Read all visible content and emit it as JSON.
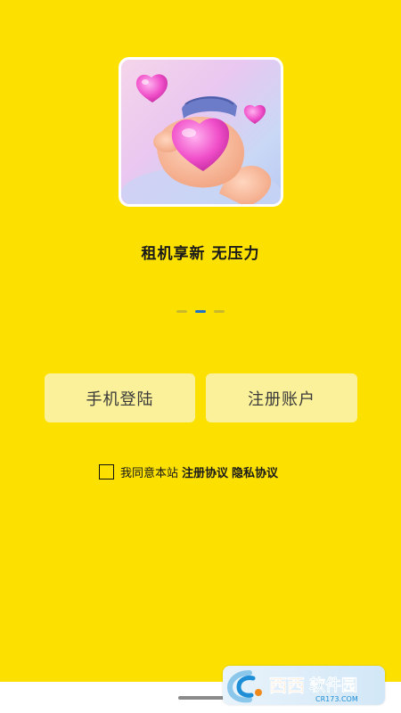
{
  "slogan": "租机享新 无压力",
  "carousel": {
    "total": 3,
    "active_index": 1
  },
  "buttons": {
    "login": "手机登陆",
    "register": "注册账户"
  },
  "agreement": {
    "checked": false,
    "prefix": "我同意本站",
    "terms_link": "注册协议",
    "privacy_link": "隐私协议"
  },
  "watermark": {
    "brand": "西西软件园",
    "url": "CR173.COM"
  },
  "colors": {
    "background": "#fbe000",
    "button_bg": "#fbf19a",
    "active_dot": "#1e73c8",
    "inactive_dot": "#c9b92a"
  },
  "icons": {
    "hero": "hearts-hand-illustration",
    "checkbox": "checkbox-unchecked"
  }
}
